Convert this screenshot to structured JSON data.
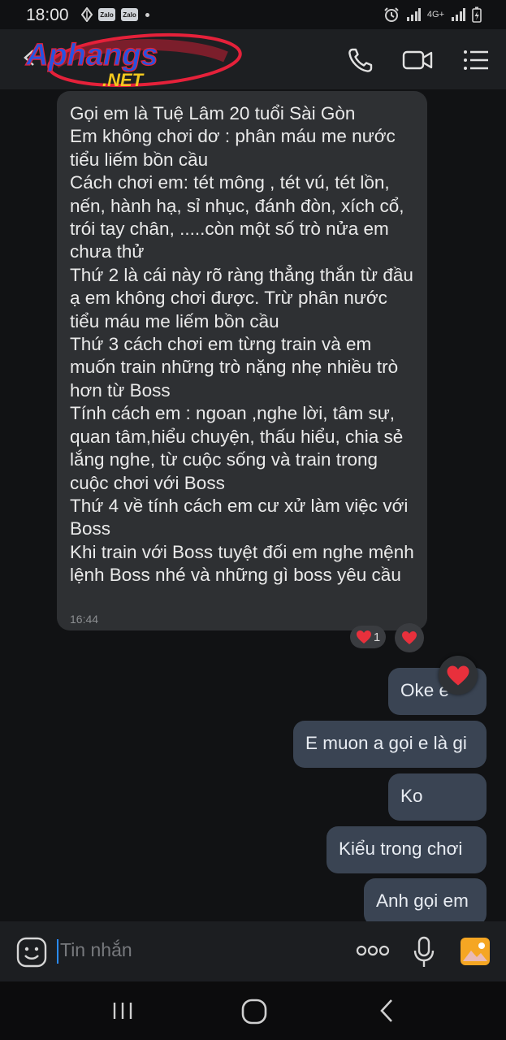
{
  "status_bar": {
    "time": "18:00",
    "zalo_badges": [
      "Zalo",
      "Zalo"
    ],
    "network": "4G+"
  },
  "header": {
    "watermark_text_main": "Aphangs",
    "watermark_text_sub": ".NET",
    "icons": [
      "back-icon",
      "phone-icon",
      "video-camera-icon",
      "list-menu-icon"
    ]
  },
  "messages": {
    "incoming": {
      "text": "Gọi em là Tuệ Lâm  20 tuổi Sài Gòn\nEm không chơi dơ : phân máu me nước tiểu liếm bồn cầu\nCách chơi em: tét mông , tét vú, tét lồn, nến, hành hạ, sỉ nhục, đánh đòn, xích cổ, trói tay chân, .....còn một số trò nửa em chưa thử\nThứ 2 là cái này rõ ràng thẳng thắn từ đầu ạ em không chơi được. Trừ phân nước tiểu máu me liếm bồn cầu\nThứ 3 cách chơi em từng train và em muốn train những trò nặng nhẹ nhiều trò hơn từ Boss\nTính cách em : ngoan ,nghe lời, tâm sự, quan tâm,hiểu chuyện, thấu hiểu, chia sẻ lắng nghe, từ cuộc sống và train trong cuộc chơi với Boss\nThứ 4 về tính cách em cư xử làm việc với Boss\nKhi train với Boss tuyệt đối em nghe mệnh lệnh Boss nhé và những gì boss yêu cầu",
      "time": "16:44",
      "reaction_count": "1"
    },
    "outgoing": [
      "Oke e",
      "E muon a gọi e là gi",
      "Ko",
      "Kiểu trong chơi",
      "Anh gọi em"
    ]
  },
  "composer": {
    "placeholder": "Tin nhắn"
  },
  "colors": {
    "incoming_bubble": "#2e3033",
    "outgoing_bubble": "#3a4453",
    "heart": "#e8303c",
    "accent": "#2a8cff",
    "image_button": "#f5a623"
  }
}
